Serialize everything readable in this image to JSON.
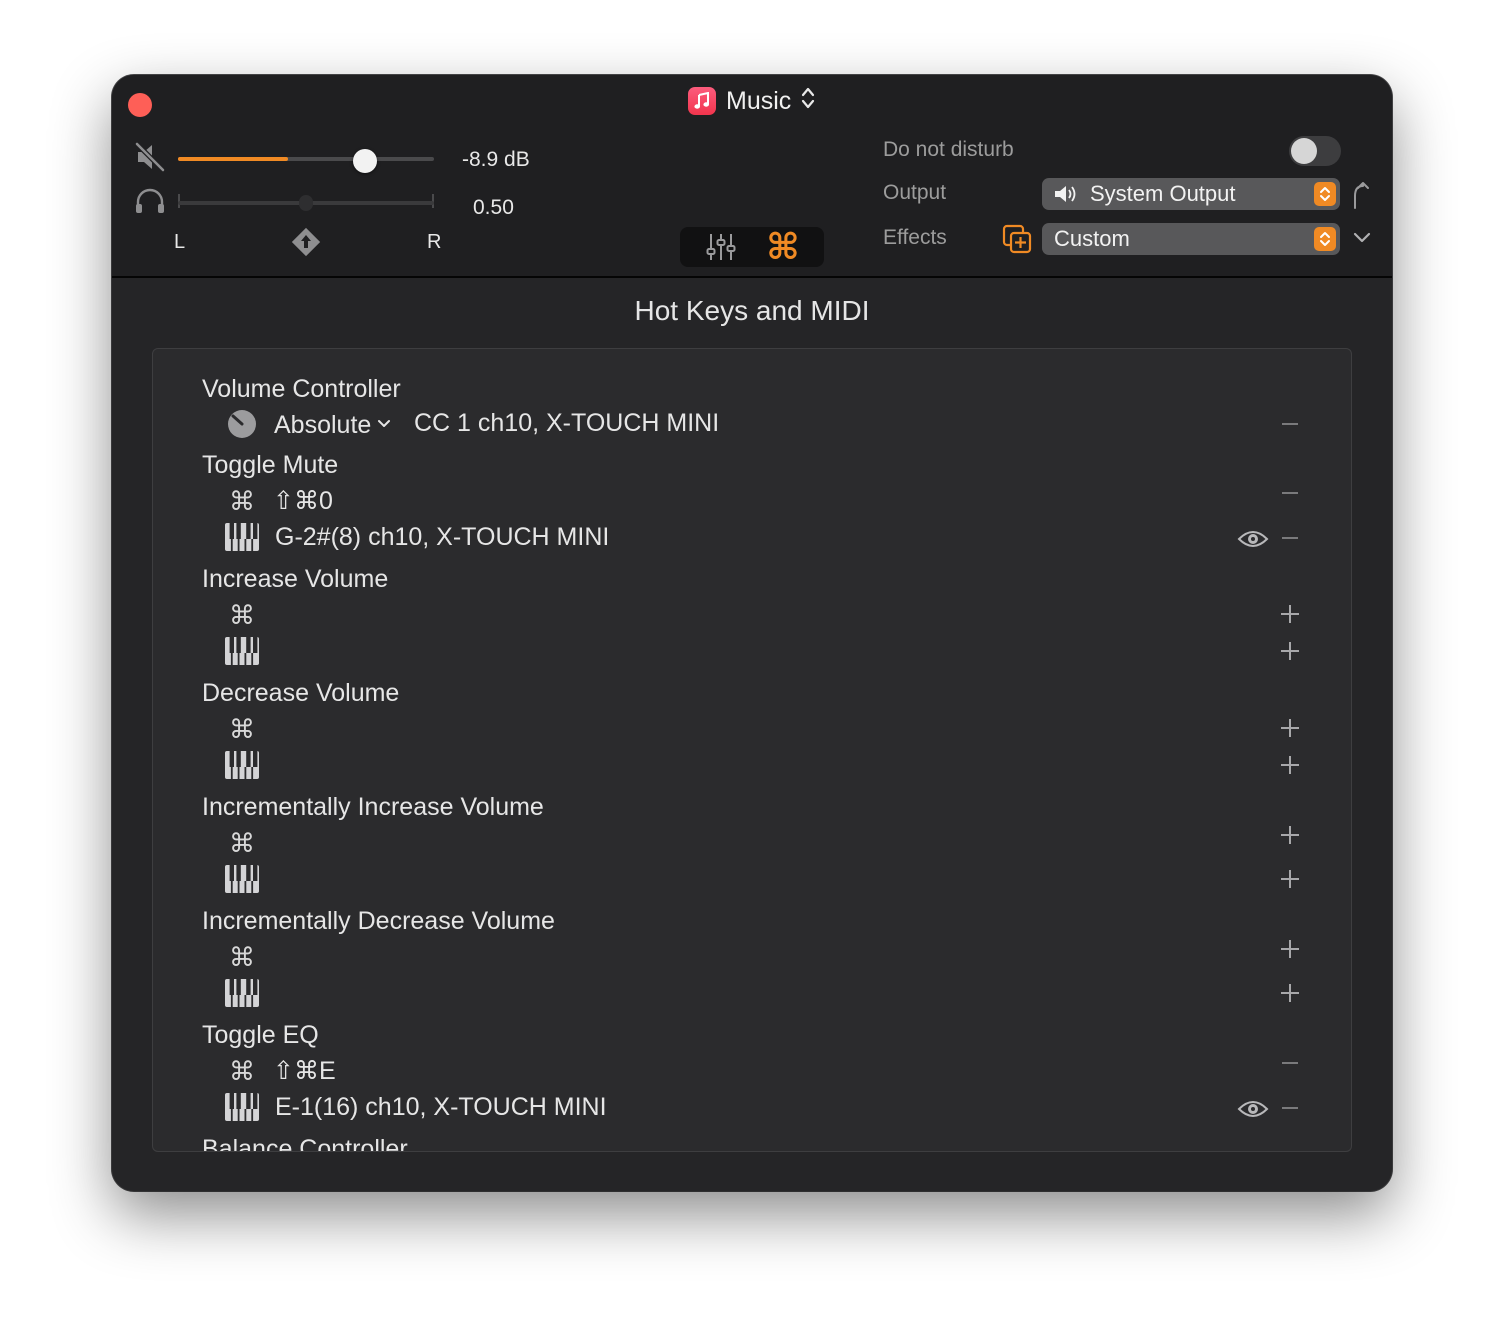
{
  "window": {
    "title": "Music"
  },
  "header": {
    "volume_db": "-8.9 dB",
    "volume_level": 0.73,
    "volume_fill": 0.43,
    "balance_value": "0.50",
    "balance_level": 0.5,
    "left_label": "L",
    "right_label": "R",
    "dnd_label": "Do not disturb",
    "dnd_on": false,
    "output_label": "Output",
    "output_value": "System Output",
    "effects_label": "Effects",
    "effects_value": "Custom"
  },
  "section_title": "Hot Keys and MIDI",
  "groups": [
    {
      "title": "Volume Controller",
      "mode": "Absolute",
      "midi": "CC 1 ch10, X-TOUCH MINI"
    },
    {
      "title": "Toggle Mute",
      "hotkey": "⇧⌘0",
      "midi": "G-2#(8) ch10, X-TOUCH MINI"
    },
    {
      "title": "Increase Volume"
    },
    {
      "title": "Decrease Volume"
    },
    {
      "title": "Incrementally Increase Volume"
    },
    {
      "title": "Incrementally Decrease Volume"
    },
    {
      "title": "Toggle EQ",
      "hotkey": "⇧⌘E",
      "midi": "E-1(16) ch10, X-TOUCH MINI"
    },
    {
      "title": "Balance Controller"
    }
  ],
  "icons": {
    "command_glyph": "⌘",
    "mute": "speaker-muted-icon",
    "headphones": "headphones-icon",
    "eq": "equalizer-sliders-icon",
    "keyboard": "piano-keys-icon",
    "knob": "knob-icon",
    "eye": "eye-icon"
  },
  "colors": {
    "accent": "#f08a24",
    "close": "#fe5f57",
    "window_bg": "#252527",
    "header_bg": "#1f1f21"
  }
}
